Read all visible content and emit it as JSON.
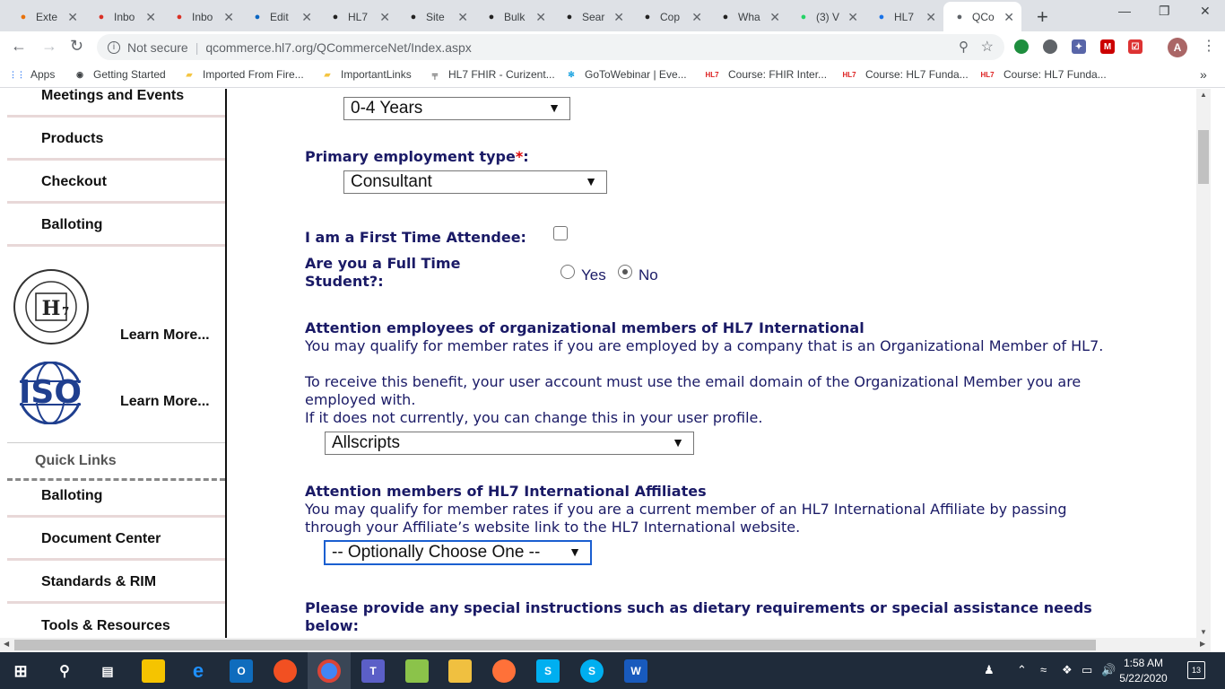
{
  "browser": {
    "tabs": [
      {
        "label": "Exte",
        "icon": "flame-icon",
        "color": "#e8710a"
      },
      {
        "label": "Inbo",
        "icon": "gmail-icon",
        "color": "#d93025"
      },
      {
        "label": "Inbo",
        "icon": "gmail-icon",
        "color": "#d93025"
      },
      {
        "label": "Edit",
        "icon": "linkedin-icon",
        "color": "#0a66c2"
      },
      {
        "label": "HL7",
        "icon": "hl7-icon",
        "color": "#222"
      },
      {
        "label": "Site",
        "icon": "hl7-icon",
        "color": "#222"
      },
      {
        "label": "Bulk",
        "icon": "hl7-icon",
        "color": "#222"
      },
      {
        "label": "Sear",
        "icon": "hl7-icon",
        "color": "#222"
      },
      {
        "label": "Cop",
        "icon": "hl7-icon",
        "color": "#222"
      },
      {
        "label": "Wha",
        "icon": "hl7-icon",
        "color": "#222"
      },
      {
        "label": "(3) V",
        "icon": "whatsapp-icon",
        "color": "#25d366"
      },
      {
        "label": "HL7",
        "icon": "c-icon",
        "color": "#1a73e8"
      },
      {
        "label": "QCo",
        "icon": "globe-icon",
        "color": "#5f6368"
      }
    ],
    "url_secure_text": "Not secure",
    "url": "qcommerce.hl7.org/QCommerceNet/Index.aspx",
    "profile_initial": "A"
  },
  "bookmarks": [
    {
      "label": "Apps",
      "icon": "apps-icon"
    },
    {
      "label": "Getting Started",
      "icon": "globe-icon"
    },
    {
      "label": "Imported From Fire...",
      "icon": "folder-icon"
    },
    {
      "label": "ImportantLinks",
      "icon": "folder-icon"
    },
    {
      "label": "HL7 FHIR - Curizent...",
      "icon": "hl7-icon"
    },
    {
      "label": "GoToWebinar | Eve...",
      "icon": "snowflake-icon"
    },
    {
      "label": "Course: FHIR Inter...",
      "icon": "hl7-logo-icon"
    },
    {
      "label": "Course: HL7 Funda...",
      "icon": "hl7-logo-icon"
    },
    {
      "label": "Course: HL7 Funda...",
      "icon": "hl7-logo-icon"
    }
  ],
  "sidebar": {
    "items": [
      "Meetings and Events",
      "Products",
      "Checkout",
      "Balloting"
    ],
    "learn_more_1": "Learn More...",
    "learn_more_2": "Learn More...",
    "iso_text": "ISO",
    "quick_links_title": "Quick Links",
    "quick_links": [
      "Balloting",
      "Document Center",
      "Standards & RIM",
      "Tools & Resources"
    ]
  },
  "form": {
    "years_select": "0-4 Years",
    "employment_label": "Primary employment type",
    "employment_required": "*",
    "employment_colon": ":",
    "employment_select": "Consultant",
    "first_time_label": "I am a First Time Attendee:",
    "student_label_1": "Are you a Full Time",
    "student_label_2": "Student?:",
    "student_yes": "Yes",
    "student_no": "No",
    "student_value": "No",
    "org_heading": "Attention employees of organizational members of HL7 International",
    "org_text_1": "You may qualify for member rates if you are employed by a company that is an Organizational Member of HL7.",
    "org_text_2": "To receive this benefit, your user account must use the email domain of the Organizational Member you are employed with.",
    "org_text_3": "If it does not currently, you can change this in your user profile.",
    "org_select": "Allscripts",
    "affiliate_heading": "Attention members of HL7 International Affiliates",
    "affiliate_text": "You may qualify for member rates if you are a current member of an HL7 International Affiliate by passing through your Affiliate’s website link to the HL7 International website.",
    "affiliate_select": "-- Optionally Choose One --",
    "special_heading": "Please provide any special instructions such as dietary requirements or special assistance needs below:"
  },
  "taskbar": {
    "time": "1:58 AM",
    "date": "5/22/2020",
    "notifications": "13"
  }
}
